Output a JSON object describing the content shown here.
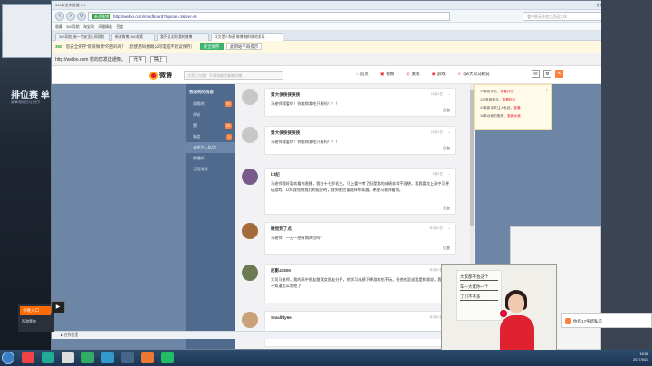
{
  "browser": {
    "title": "360安全浏览器 8.1",
    "menu": [
      "文件",
      "查看",
      "收藏",
      "工具",
      "帮助"
    ],
    "url_tag": "新浪微博",
    "url": "http://weibo.com/mindboard?topnav=1&wvr=6",
    "search_placeholder": "看中秋天外加大活动大伙",
    "bookmarks": [
      "收藏",
      "360导航",
      "淘宝网",
      "天猫精选",
      "百度"
    ],
    "tabs": [
      "360导航_新一代安全上网导航",
      "新浪微博_360搜索",
      "我不见太阳/我的微博",
      "发文是人和画 微博-随时随地发现"
    ],
    "bar360": {
      "logo": "360",
      "text": "您安全保存“新浪微博”的密码吗？（您使用同相端公司电脑不建议保存）",
      "save_btn": "安全保存",
      "never_btn": "此网站不再提示"
    },
    "push": {
      "text": "http://weibo.com 想向您发送通知。",
      "allow": "允许",
      "deny": "禁止"
    },
    "status": "▶ 在你这里",
    "zoom": "100%"
  },
  "weibo": {
    "logo": "微博",
    "search_placeholder": "大家正在搜：不限流量套餐被拒赠",
    "nav": [
      "首页",
      "视频",
      "发现",
      "游戏",
      "cjw大司马解说"
    ],
    "sidebar_header": "我收到的消息",
    "sidebar_items": [
      {
        "label": "@我的",
        "count": "99"
      },
      {
        "label": "评论",
        "count": ""
      },
      {
        "label": "赞",
        "count": "99"
      },
      {
        "label": "私信",
        "count": "1"
      },
      {
        "label": "未关注人私信",
        "count": ""
      },
      {
        "label": "群通知",
        "count": ""
      },
      {
        "label": "订阅消息",
        "count": ""
      }
    ],
    "messages": [
      {
        "name": "第大侠侠侠侠侠",
        "time": "10月3日",
        "text": "马老师我爱你！你能和我吃只麦吗！！！",
        "reply": "回复"
      },
      {
        "name": "第大侠侠侠侠侠",
        "time": "10月3日",
        "text": "马老师我爱你！你能和我吃只麦吗！！！",
        "reply": "回复"
      },
      {
        "name": "lxl纪",
        "time": "9月5日",
        "text": "马老师我好喜欢看你直播，我在十七岁初三。马上要中考了但是我的成绩非常不理想，我我喜欢上高中又便玩游戏，LOL我觉得我打的挺好的，我到底应该选择哪条路，希望马老师看到。",
        "reply": "回复"
      },
      {
        "name": "睡觉到了点",
        "time": "11月10日",
        "text": "马老师，一天一把有病两位吗？",
        "reply": "回复"
      },
      {
        "name": "厄影41500",
        "time": "11月10日",
        "text": "大司马老师，我的高中朋友跟我女朋友分手，他学习成绩下降游戏也不玩，但他也没说我是和我说，我会在不知道怎么劝他了",
        "reply": "回复"
      },
      {
        "name": "Smallfly6e",
        "time": "11月10日",
        "text": "",
        "reply": ""
      }
    ],
    "msg_panel": [
      {
        "text": "33条新评论，",
        "link": "查看评论"
      },
      {
        "text": "120条新粉丝，",
        "link": "查看粉丝"
      },
      {
        "text": "41条新未关注人私信，",
        "link": "查看"
      },
      {
        "text": "16条@我的微博，",
        "link": "查看@我"
      }
    ]
  },
  "notification": {
    "text": "你有17条新私信"
  },
  "left_bg": {
    "title": "排位赛 单",
    "sub": "赛事直播正在进行"
  },
  "promo": {
    "btn": "今晚入口",
    "text": "西游等你"
  },
  "webcam_board": [
    "大家都不会这个",
    "车一大家你一个",
    "了们不不多"
  ],
  "tray": {
    "time": "18:53",
    "date": "2017/9/21"
  }
}
